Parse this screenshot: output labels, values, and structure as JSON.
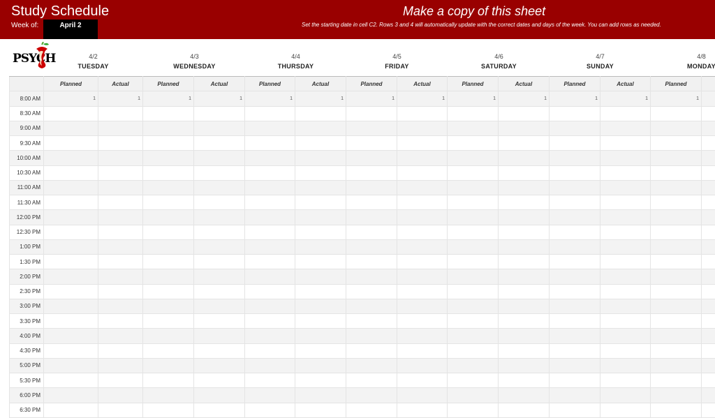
{
  "header": {
    "title": "Study Schedule",
    "week_of_label": "Week of:",
    "start_date": "April 2",
    "copy_notice": "Make a copy of this sheet",
    "instructions": "Set the starting date in cell C2. Rows 3 and 4 will automatically update with the correct dates and days of the week. You can add rows as needed."
  },
  "logo": {
    "text": "PSYCH",
    "icon": "apple-core-icon"
  },
  "subheaders": {
    "planned": "Planned",
    "actual": "Actual"
  },
  "days": [
    {
      "date": "4/2",
      "name": "TUESDAY"
    },
    {
      "date": "4/3",
      "name": "WEDNESDAY"
    },
    {
      "date": "4/4",
      "name": "THURSDAY"
    },
    {
      "date": "4/5",
      "name": "FRIDAY"
    },
    {
      "date": "4/6",
      "name": "SATURDAY"
    },
    {
      "date": "4/7",
      "name": "SUNDAY"
    },
    {
      "date": "4/8",
      "name": "MONDAY"
    }
  ],
  "times": [
    "8:00 AM",
    "8:30 AM",
    "9:00 AM",
    "9:30 AM",
    "10:00 AM",
    "10:30 AM",
    "11:00 AM",
    "11:30 AM",
    "12:00 PM",
    "12:30 PM",
    "1:00 PM",
    "1:30 PM",
    "2:00 PM",
    "2:30 PM",
    "3:00 PM",
    "3:30 PM",
    "4:00 PM",
    "4:30 PM",
    "5:00 PM",
    "5:30 PM",
    "6:00 PM",
    "6:30 PM"
  ],
  "first_row_values": [
    "1",
    "1",
    "1",
    "1",
    "1",
    "1",
    "1",
    "1",
    "1",
    "1",
    "1",
    "1",
    "1",
    ""
  ],
  "colors": {
    "banner": "#990000",
    "date_box": "#000000",
    "shade": "#f3f3f3"
  }
}
